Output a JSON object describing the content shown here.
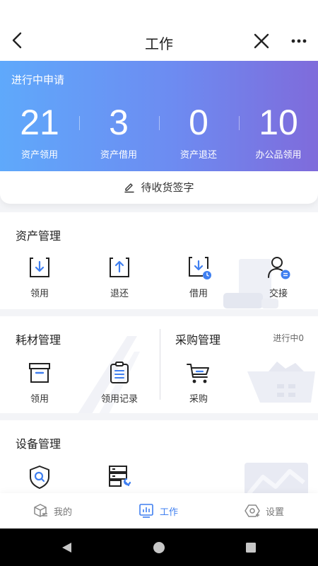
{
  "header": {
    "title": "工作"
  },
  "hero": {
    "title": "进行中申请",
    "stats": [
      {
        "value": "21",
        "label": "资产领用"
      },
      {
        "value": "3",
        "label": "资产借用"
      },
      {
        "value": "0",
        "label": "资产退还"
      },
      {
        "value": "10",
        "label": "办公品领用"
      }
    ]
  },
  "pending": {
    "label": "待收货签字"
  },
  "asset": {
    "title": "资产管理",
    "items": [
      {
        "label": "领用",
        "icon": "receive-icon"
      },
      {
        "label": "退还",
        "icon": "return-icon"
      },
      {
        "label": "借用",
        "icon": "borrow-icon"
      },
      {
        "label": "交接",
        "icon": "handover-icon"
      }
    ]
  },
  "consumables": {
    "title": "耗材管理",
    "items": [
      {
        "label": "领用",
        "icon": "box-icon"
      },
      {
        "label": "领用记录",
        "icon": "clipboard-icon"
      }
    ]
  },
  "purchase": {
    "title": "采购管理",
    "status": "进行中0",
    "items": [
      {
        "label": "采购",
        "icon": "cart-icon"
      }
    ]
  },
  "equipment": {
    "title": "设备管理"
  },
  "tabs": [
    {
      "label": "我的",
      "icon": "cube-icon"
    },
    {
      "label": "工作",
      "icon": "dashboard-icon"
    },
    {
      "label": "设置",
      "icon": "settings-icon"
    }
  ],
  "colors": {
    "accent": "#3f7ff0",
    "hero_start": "#5fa9fb",
    "hero_end": "#7f6bdb"
  }
}
